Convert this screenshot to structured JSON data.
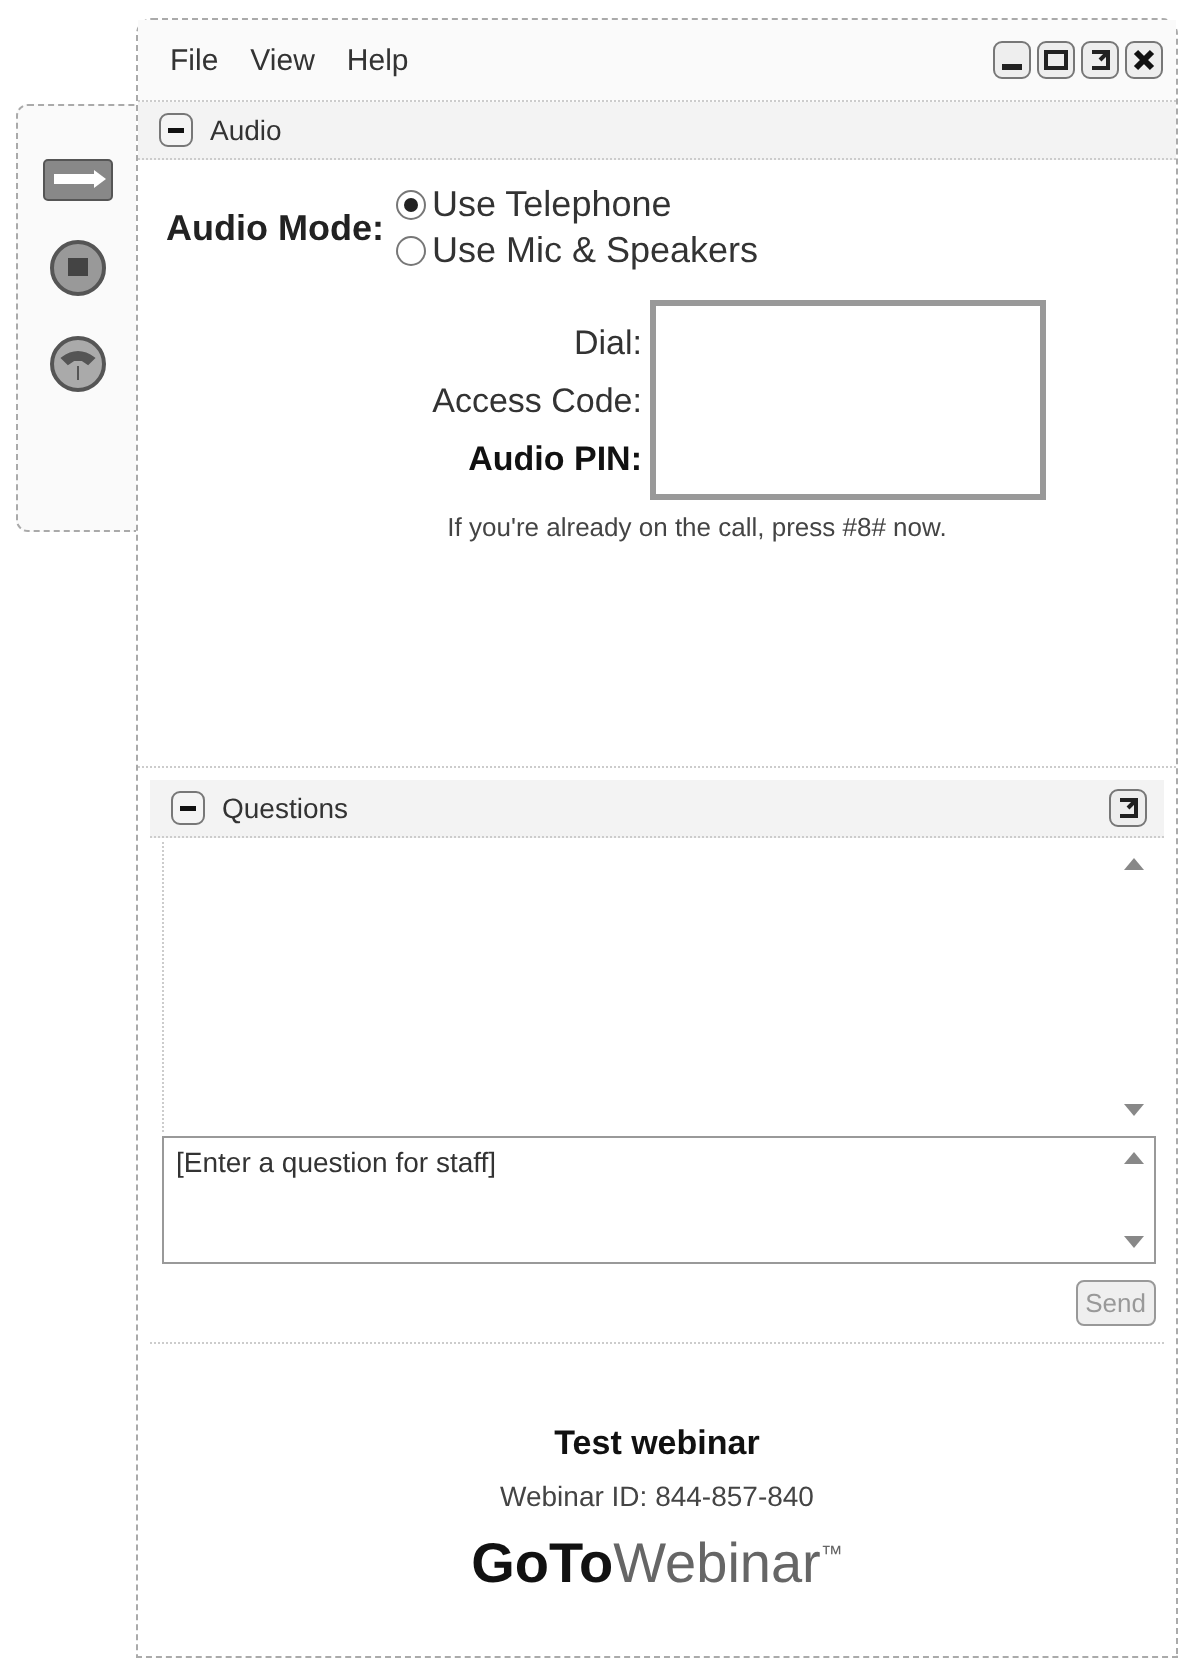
{
  "menu": [
    "File",
    "View",
    "Help"
  ],
  "audio": {
    "title": "Audio",
    "expanded": true,
    "mode_label": "Audio Mode:",
    "options": [
      {
        "label": "Use Telephone",
        "selected": true
      },
      {
        "label": "Use Mic & Speakers",
        "selected": false
      }
    ],
    "fields": [
      {
        "label": "Dial:",
        "emphasized": false
      },
      {
        "label": "Access Code:",
        "emphasized": false
      },
      {
        "label": "Audio PIN:",
        "emphasized": true
      }
    ],
    "note": "If you're already on the call, press #8# now."
  },
  "questions": {
    "title": "Questions",
    "expanded": true,
    "input": {
      "placeholder": "[Enter a question for staff]"
    },
    "send": {
      "label": "Send",
      "disabled": true
    }
  },
  "footer": {
    "webinar_name": "Test webinar",
    "webinar_id": "Webinar ID: 844-857-840",
    "logo": "**GoTo**Webinar$^{™}$"
  }
}
